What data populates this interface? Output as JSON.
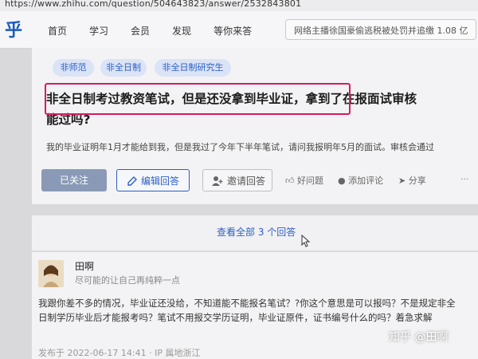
{
  "url": "https://www.zhihu.com/question/504643823/answer/2532843801",
  "logo": "乎",
  "nav": [
    "首页",
    "学习",
    "会员",
    "发现",
    "等你来答"
  ],
  "search_placeholder": "网络主播徐国豪偷逃税被处罚并追缴 1.08 亿",
  "tags": [
    "非师范",
    "非全日制",
    "非全日制研究生"
  ],
  "question": {
    "title_part1": "非全日制考过教资笔试，但是还没拿到毕业证，",
    "title_part2": "拿到了在报面试审核",
    "title_line2": "能过吗?",
    "description": "我的毕业证明年1月才能给到我，但是我过了今年下半年笔试，请问我报明年5月的面试。审核会通过"
  },
  "actions": {
    "follow": "已关注",
    "edit_answer": "编辑回答",
    "invite": "邀请回答",
    "good_question": "好问题",
    "add_comment": "添加评论",
    "share": "分享"
  },
  "view_all": "查看全部 3 个回答",
  "answer": {
    "author": "田啊",
    "bio": "尽可能的让自己再纯粹一点",
    "body": "我跟你差不多的情况，毕业证还没给，不知道能不能报名笔试？?你这个意思是可以报吗？不是规定非全日制学历毕业后才能报考吗？笔试不用报交学历证明，毕业证原件，证书编号什么的吗？着急求解",
    "meta": "发布于 2022-06-17 14:41 · IP 属地浙江"
  },
  "watermark": "知乎 @田啊",
  "colors": {
    "brand": "#1a5bbf",
    "highlight_box": "#d81b60",
    "follow_btn": "#8a9ab6"
  }
}
